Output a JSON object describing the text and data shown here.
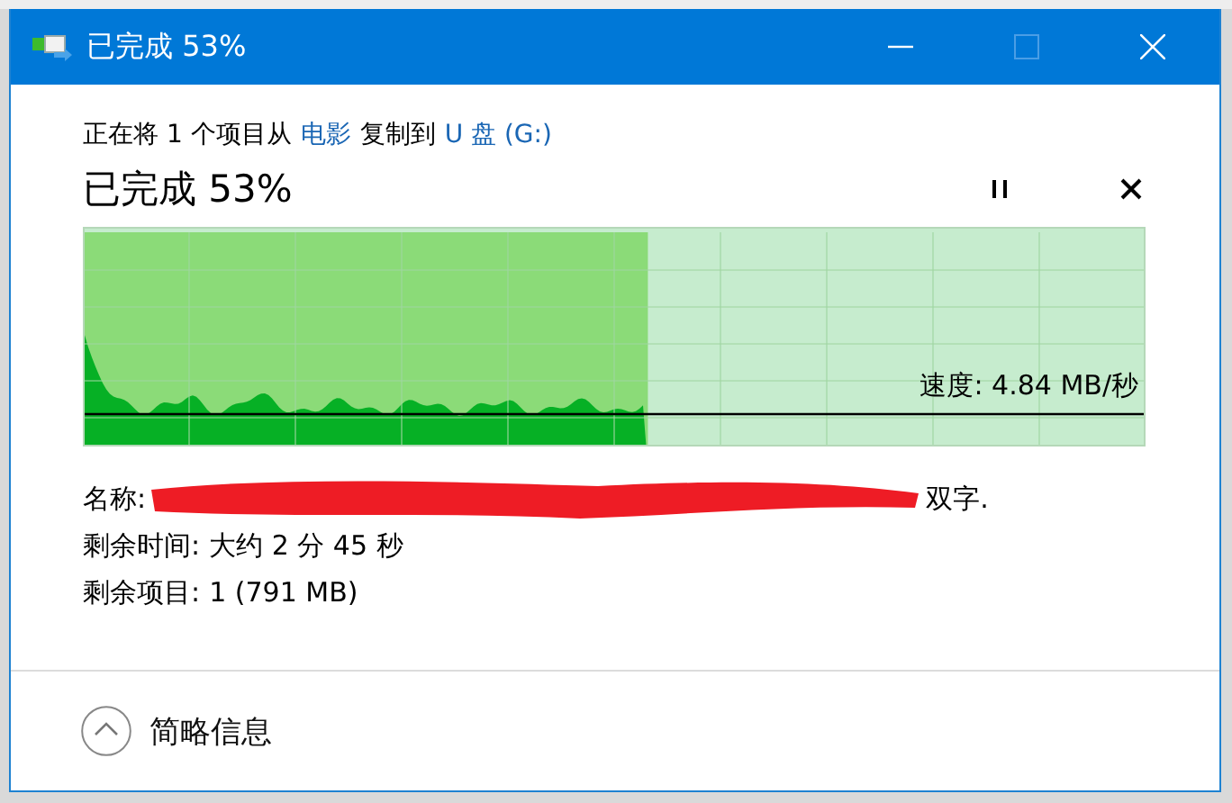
{
  "window": {
    "title": "已完成 53%"
  },
  "caption": [
    {
      "kind": "text",
      "text": "正在将 1 个项目从"
    },
    {
      "kind": "link",
      "text": "电影"
    },
    {
      "kind": "text",
      "text": "复制到"
    },
    {
      "kind": "link",
      "text": "U 盘 (G:)"
    }
  ],
  "progress": {
    "heading": "已完成 53%",
    "level": 0.53,
    "speed": "速度: 4.84 MB/秒"
  },
  "details": [
    {
      "label": "名称:",
      "value": "双字.",
      "redacted": true
    },
    {
      "label": "剩余时间:",
      "value": "大约 2 分 45 秒",
      "redacted": false
    },
    {
      "label": "剩余项目:",
      "value": "1 (791 MB)",
      "redacted": false
    }
  ],
  "footer": {
    "label": "简略信息",
    "expanded": true
  }
}
